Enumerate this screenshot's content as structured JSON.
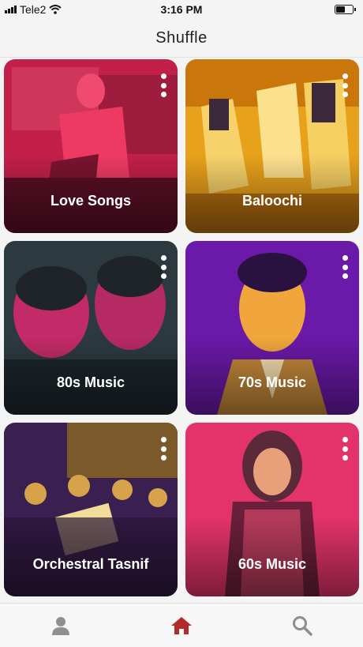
{
  "status": {
    "carrier": "Tele2",
    "time": "3:16 PM",
    "battery_level": 0.55
  },
  "nav": {
    "title": "Shuffle"
  },
  "colors": {
    "accent": "#b22a2a",
    "tab_inactive": "#8f8f8f"
  },
  "cards": [
    {
      "label": "Love Songs",
      "theme": "#c8234d",
      "icon": "kebab-icon"
    },
    {
      "label": "Baloochi",
      "theme": "#e7a215",
      "icon": "kebab-icon"
    },
    {
      "label": "80s Music",
      "theme": "#2d3940",
      "icon": "kebab-icon"
    },
    {
      "label": "70s Music",
      "theme": "#6a1aa6",
      "icon": "kebab-icon"
    },
    {
      "label": "Orchestral Tasnif",
      "theme": "#3a2054",
      "icon": "kebab-icon"
    },
    {
      "label": "60s Music",
      "theme": "#e5336a",
      "icon": "kebab-icon"
    }
  ],
  "tabs": [
    {
      "name": "profile",
      "icon": "person-icon",
      "active": false
    },
    {
      "name": "home",
      "icon": "home-icon",
      "active": true
    },
    {
      "name": "search",
      "icon": "search-icon",
      "active": false
    }
  ]
}
